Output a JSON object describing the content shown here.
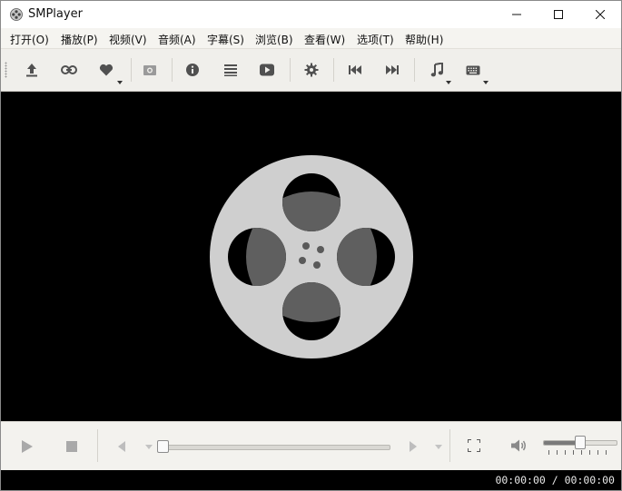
{
  "window": {
    "title": "SMPlayer",
    "app_icon": "film-reel-icon",
    "controls": [
      "minimize-icon",
      "maximize-icon",
      "close-icon"
    ]
  },
  "menubar": {
    "items": [
      {
        "label": "打开(O)"
      },
      {
        "label": "播放(P)"
      },
      {
        "label": "视频(V)"
      },
      {
        "label": "音频(A)"
      },
      {
        "label": "字幕(S)"
      },
      {
        "label": "浏览(B)"
      },
      {
        "label": "查看(W)"
      },
      {
        "label": "选项(T)"
      },
      {
        "label": "帮助(H)"
      }
    ]
  },
  "toolbar": {
    "buttons": [
      {
        "icon": "open-file-icon"
      },
      {
        "icon": "open-url-icon"
      },
      {
        "icon": "favorites-heart-icon",
        "has_dropdown": true
      },
      {
        "icon": "screenshot-camera-icon"
      },
      {
        "icon": "info-icon"
      },
      {
        "icon": "playlist-icon"
      },
      {
        "icon": "play-video-icon"
      },
      {
        "icon": "settings-gear-icon"
      },
      {
        "icon": "previous-track-icon"
      },
      {
        "icon": "next-track-icon"
      },
      {
        "icon": "audio-track-icon",
        "has_dropdown": true
      },
      {
        "icon": "keyboard-subtitle-icon",
        "has_dropdown": true
      }
    ]
  },
  "video": {
    "background": "#000000",
    "placeholder_icon": "film-reel-icon",
    "reel_color": "#cfcfcf",
    "reel_dark": "#5f5f5f"
  },
  "playback": {
    "buttons": [
      "play-icon",
      "stop-icon",
      "rewind-icon",
      "forward-icon",
      "fullscreen-icon",
      "volume-icon"
    ],
    "seek_position": 0,
    "volume_level": 0.5
  },
  "status": {
    "time": "00:00:00 / 00:00:00"
  }
}
